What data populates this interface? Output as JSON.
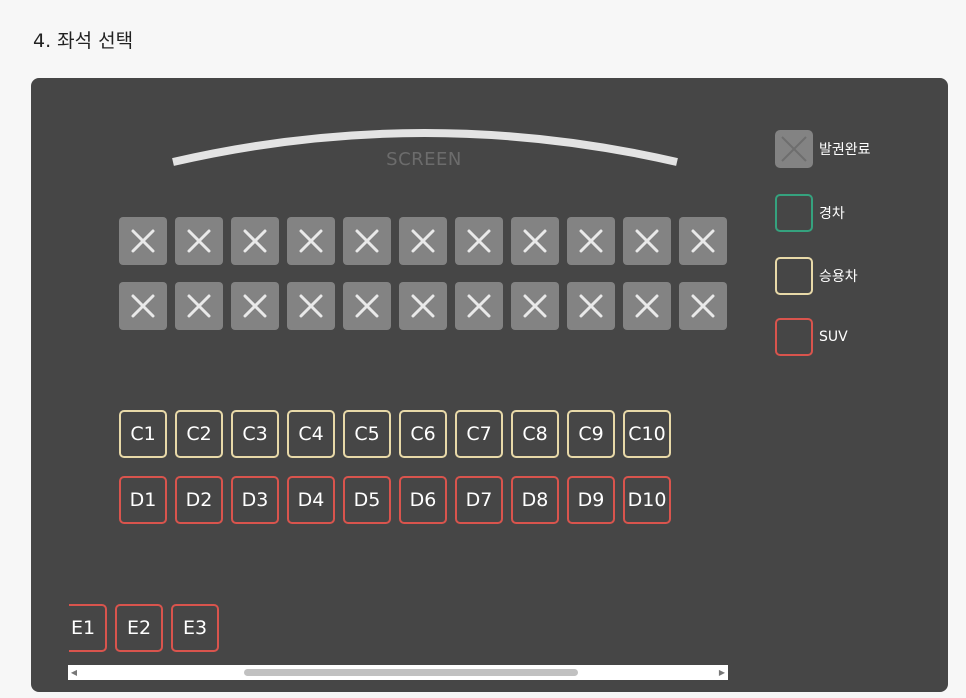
{
  "section_title": "4. 좌석 선택",
  "screen_label": "SCREEN",
  "rows": {
    "row_a_count": 11,
    "row_b_count": 11,
    "row_c": [
      "C1",
      "C2",
      "C3",
      "C4",
      "C5",
      "C6",
      "C7",
      "C8",
      "C9",
      "C10"
    ],
    "row_d": [
      "D1",
      "D2",
      "D3",
      "D4",
      "D5",
      "D6",
      "D7",
      "D8",
      "D9",
      "D10"
    ],
    "row_e": [
      "E1",
      "E2",
      "E3"
    ]
  },
  "legend": {
    "done": "발권완료",
    "compact": "경차",
    "sedan": "승용차",
    "suv": "SUV"
  },
  "colors": {
    "panel_bg": "#464646",
    "sold_seat": "#838383",
    "compact": "#35a27e",
    "sedan": "#e8d9a8",
    "suv": "#d9544d"
  },
  "icons": {
    "sold_mark": "x-icon",
    "scroll_left": "triangle-left-icon",
    "scroll_right": "triangle-right-icon"
  }
}
